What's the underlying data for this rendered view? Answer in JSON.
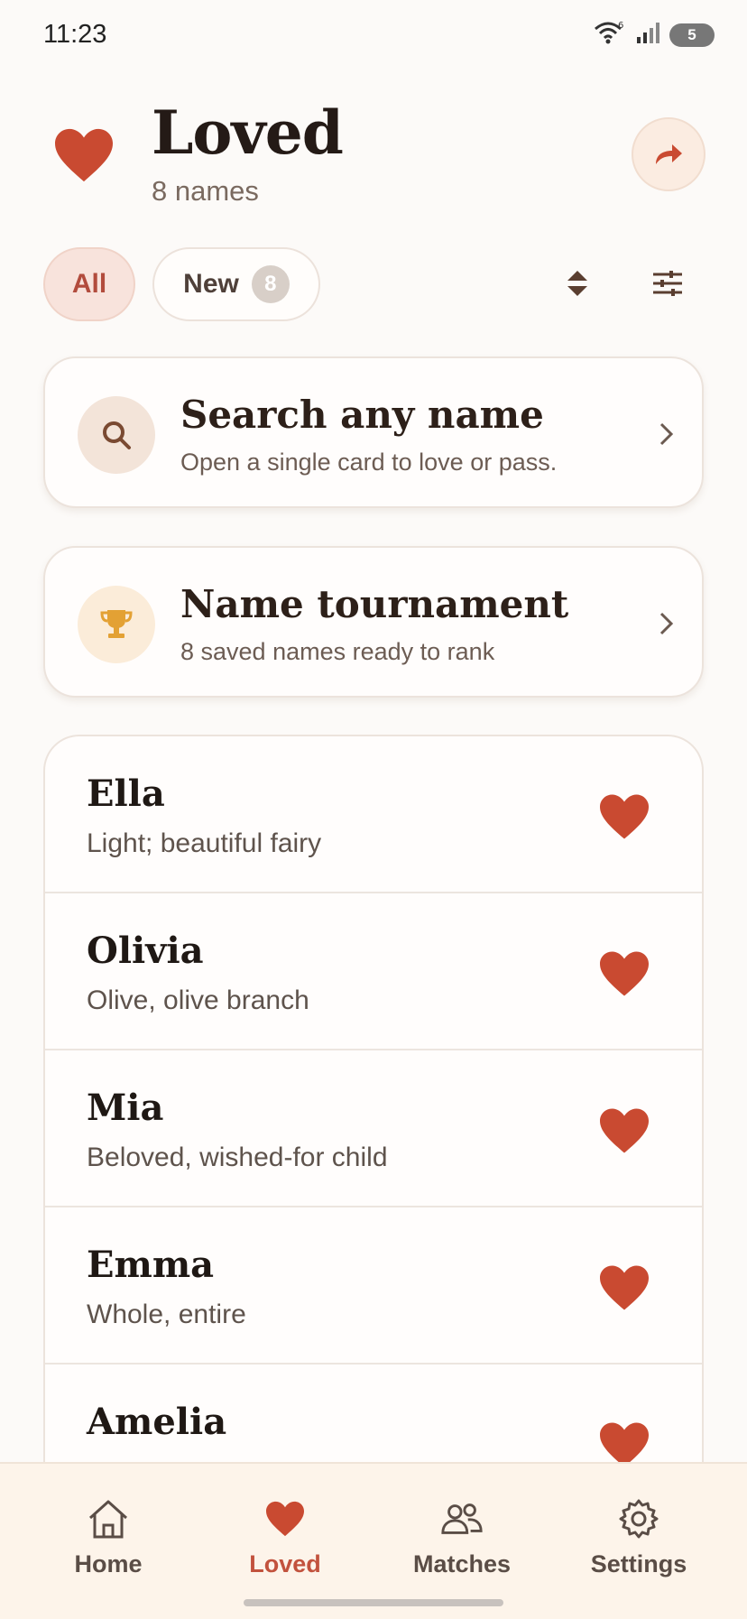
{
  "status_bar": {
    "time": "11:23",
    "wifi_badge": "6",
    "battery": "5"
  },
  "header": {
    "title": "Loved",
    "subtitle": "8 names"
  },
  "filters": {
    "all_label": "All",
    "new_label": "New",
    "new_count": "8"
  },
  "cards": {
    "search": {
      "title": "Search any name",
      "description": "Open a single card to love or pass."
    },
    "tournament": {
      "title": "Name tournament",
      "description": "8 saved names ready to rank"
    }
  },
  "names": [
    {
      "name": "Ella",
      "meaning": "Light; beautiful fairy"
    },
    {
      "name": "Olivia",
      "meaning": "Olive, olive branch"
    },
    {
      "name": "Mia",
      "meaning": "Beloved, wished-for child"
    },
    {
      "name": "Emma",
      "meaning": "Whole, entire"
    },
    {
      "name": "Amelia",
      "meaning": ""
    }
  ],
  "nav": {
    "home": "Home",
    "loved": "Loved",
    "matches": "Matches",
    "settings": "Settings"
  },
  "colors": {
    "accent": "#c2523d",
    "heart": "#c94a31",
    "background": "#fcfaf8"
  }
}
